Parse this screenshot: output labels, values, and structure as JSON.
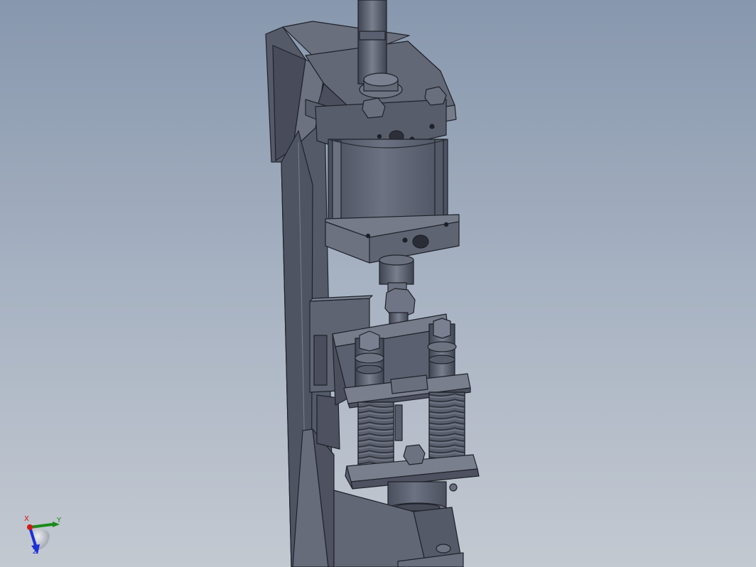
{
  "viewport": {
    "background_top": "#8797ad",
    "background_bottom": "#c3c9d1",
    "model_color": "#5c6172"
  },
  "triad": {
    "x_label": "X",
    "y_label": "Y",
    "z_label": "Z",
    "x_color": "#d21818",
    "y_color": "#1a8a1a",
    "z_color": "#1d2fd6"
  }
}
